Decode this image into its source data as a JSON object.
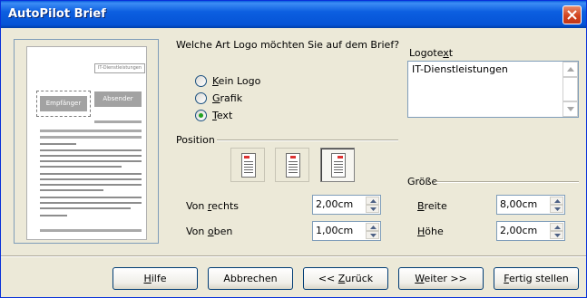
{
  "window": {
    "title": "AutoPilot Brief"
  },
  "preview": {
    "logo_text": "IT-Dienstleistungen",
    "recipient": "Empfänger",
    "sender": "Absender"
  },
  "logo_question": "Welche Art Logo möchten Sie auf dem Brief?",
  "logo_options": [
    {
      "prefix": "",
      "accel": "K",
      "rest": "ein Logo",
      "checked": false
    },
    {
      "prefix": "",
      "accel": "G",
      "rest": "rafik",
      "checked": false
    },
    {
      "prefix": "",
      "accel": "T",
      "rest": "ext",
      "checked": true
    }
  ],
  "logotext": {
    "label_prefix": "Logote",
    "label_accel": "x",
    "label_rest": "t",
    "value": "IT-Dienstleistungen"
  },
  "position": {
    "label": "Position",
    "buttons": [
      "align-left-icon",
      "align-center-icon",
      "align-right-icon"
    ],
    "active_index": 2
  },
  "offsets": {
    "right": {
      "label_prefix": "Von ",
      "label_accel": "r",
      "label_rest": "echts",
      "value": "2,00cm"
    },
    "top": {
      "label_prefix": "Von ",
      "label_accel": "o",
      "label_rest": "ben",
      "value": "1,00cm"
    }
  },
  "size": {
    "label": "Größe",
    "width": {
      "label_prefix": "",
      "label_accel": "B",
      "label_rest": "reite",
      "value": "8,00cm"
    },
    "height": {
      "label_prefix": "",
      "label_accel": "H",
      "label_rest": "öhe",
      "value": "2,00cm"
    }
  },
  "buttons": {
    "help": {
      "prefix": "",
      "accel": "H",
      "rest": "ilfe"
    },
    "cancel": {
      "label": "Abbrechen"
    },
    "back": {
      "prefix": "<< ",
      "accel": "Z",
      "rest": "urück"
    },
    "next": {
      "prefix": "",
      "accel": "W",
      "rest": "eiter >>"
    },
    "finish": {
      "prefix": "",
      "accel": "F",
      "rest": "ertig stellen"
    }
  },
  "colors": {
    "titlebar": "#0553d6",
    "dialog_bg": "#ece9d8",
    "radio_dot": "#21a121"
  }
}
